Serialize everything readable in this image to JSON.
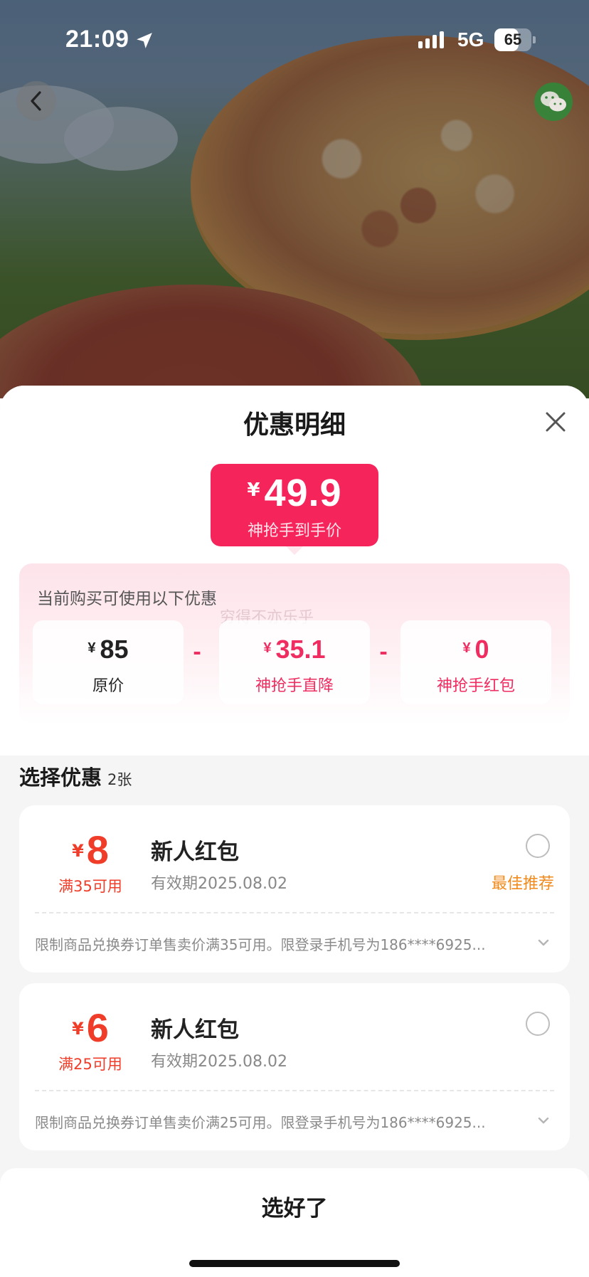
{
  "status_bar": {
    "time": "21:09",
    "network": "5G",
    "battery_percent": 65,
    "battery_label": "65"
  },
  "nav": {
    "back_icon": "chevron-left-icon",
    "share_icon": "wechat-icon"
  },
  "sheet": {
    "title": "优惠明细",
    "close_icon": "close-icon",
    "price": {
      "symbol": "¥",
      "value": "49.9",
      "label": "神抢手到手价"
    },
    "breakdown": {
      "title": "当前购买可使用以下优惠",
      "watermark": "穷得不亦乐乎",
      "minus": "-",
      "items": [
        {
          "symbol": "¥",
          "value": "85",
          "label": "原价"
        },
        {
          "symbol": "¥",
          "value": "35.1",
          "label": "神抢手直降"
        },
        {
          "symbol": "¥",
          "value": "0",
          "label": "神抢手红包"
        }
      ]
    },
    "select": {
      "title": "选择优惠",
      "count": "2张"
    },
    "coupons": [
      {
        "symbol": "¥",
        "amount": "8",
        "condition": "满35可用",
        "title": "新人红包",
        "validity": "有效期2025.08.02",
        "recommend": "最佳推荐",
        "selected": false,
        "description": "限制商品兑换券订单售卖价满35可用。限登录手机号为186****6925..."
      },
      {
        "symbol": "¥",
        "amount": "6",
        "condition": "满25可用",
        "title": "新人红包",
        "validity": "有效期2025.08.02",
        "recommend": "",
        "selected": false,
        "description": "限制商品兑换券订单售卖价满25可用。限登录手机号为186****6925..."
      }
    ],
    "confirm_label": "选好了"
  },
  "colors": {
    "accent_pink": "#f5245b",
    "price_red": "#ef2d61",
    "coupon_red": "#ef3d2a",
    "recommend_orange": "#f08a1c"
  }
}
